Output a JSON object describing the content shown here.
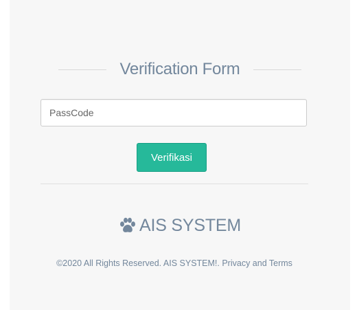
{
  "form": {
    "title": "Verification Form",
    "passcode_placeholder": "PassCode",
    "passcode_value": "",
    "submit_label": "Verifikasi"
  },
  "brand": {
    "icon": "paw-icon",
    "name": "AIS SYSTEM"
  },
  "footer": {
    "copyright": "©2020 All Rights Reserved. AIS SYSTEM!. Privacy and Terms"
  },
  "colors": {
    "accent": "#26b99a",
    "text": "#73879c",
    "panel_background": "#f7f7f7"
  }
}
